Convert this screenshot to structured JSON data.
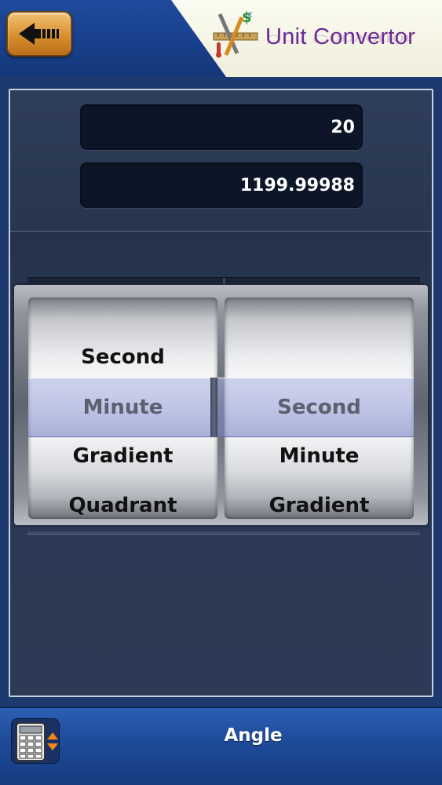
{
  "header": {
    "back_icon": "back-arrow-icon",
    "app_title": "Unit Convertor",
    "logo_icon": "tools-dollar-icon"
  },
  "converter": {
    "input_value": "20",
    "result_value": "1199.99988"
  },
  "picker": {
    "from_column": {
      "items_above": [
        "Second"
      ],
      "selected": "Minute",
      "items_below": [
        "Gradient",
        "Quadrant"
      ]
    },
    "to_column": {
      "items_above": [
        ""
      ],
      "selected": "Second",
      "items_below": [
        "Minute",
        "Gradient"
      ]
    }
  },
  "footer": {
    "calculator_icon": "calculator-icon",
    "category": "Angle"
  },
  "colors": {
    "header_blue": "#1f4a9c",
    "back_button_orange": "#d8902f",
    "logo_purple": "#6a2a93",
    "panel_bg": "#2c3a53",
    "field_bg": "#0d1628",
    "selection_tint": "#8f98d4"
  }
}
